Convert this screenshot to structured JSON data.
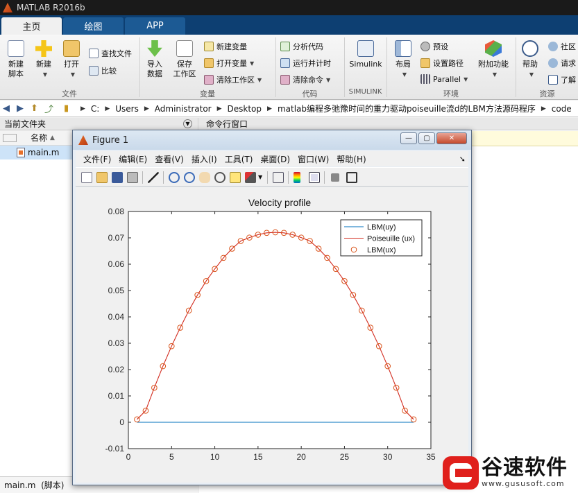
{
  "window": {
    "title": "MATLAB R2016b"
  },
  "tabs": [
    {
      "label": "主页",
      "active": true
    },
    {
      "label": "绘图",
      "active": false
    },
    {
      "label": "APP",
      "active": false
    }
  ],
  "ribbon": {
    "new_script": "新建\n脚本",
    "new": "新建",
    "open": "打开",
    "find_files": "查找文件",
    "compare": "比较",
    "import_data": "导入\n数据",
    "save_workspace": "保存\n工作区",
    "new_variable": "新建变量",
    "open_variable": "打开变量",
    "clear_workspace": "清除工作区",
    "analyze_code": "分析代码",
    "run_and_time": "运行并计时",
    "clear_commands": "清除命令",
    "simulink": "Simulink",
    "layout": "布局",
    "preferences": "预设",
    "set_path": "设置路径",
    "parallel": "Parallel",
    "addons": "附加功能",
    "help": "帮助",
    "community": "社区",
    "request": "请求",
    "learn": "了解",
    "groups": [
      "文件",
      "变量",
      "代码",
      "SIMULINK",
      "环境",
      "资源"
    ]
  },
  "address": {
    "crumbs": [
      "C:",
      "Users",
      "Administrator",
      "Desktop",
      "matlab编程多弛豫时间的重力驱动poiseuille流d的LBM方法源码程序",
      "code"
    ]
  },
  "file_browser": {
    "title": "当前文件夹",
    "col_name": "名称",
    "col_sort": "▲",
    "files": [
      {
        "name": "main.m"
      }
    ],
    "footer": "main.m  (脚本)"
  },
  "command_window": {
    "title": "命令行窗口"
  },
  "figure": {
    "title": "Figure 1",
    "menu": [
      "文件(F)",
      "编辑(E)",
      "查看(V)",
      "插入(I)",
      "工具(T)",
      "桌面(D)",
      "窗口(W)",
      "帮助(H)"
    ],
    "menu_arrow": "➘",
    "minimize": "—",
    "maximize": "▢",
    "close": "✕"
  },
  "chart_data": {
    "type": "line",
    "title": "Velocity profile",
    "xlabel": "",
    "ylabel": "",
    "xlim": [
      0,
      35
    ],
    "ylim": [
      -0.01,
      0.08
    ],
    "xticks": [
      0,
      5,
      10,
      15,
      20,
      25,
      30,
      35
    ],
    "yticks": [
      -0.01,
      0,
      0.01,
      0.02,
      0.03,
      0.04,
      0.05,
      0.06,
      0.07,
      0.08
    ],
    "grid": false,
    "legend": "top-right",
    "series": [
      {
        "name": "LBM(uy)",
        "kind": "line",
        "color": "#0072bd",
        "x": [
          1,
          33
        ],
        "y": [
          0,
          0
        ]
      },
      {
        "name": "Poiseuille (ux)",
        "kind": "line",
        "color": "#d22a1e",
        "x": [
          1,
          2,
          3,
          4,
          5,
          6,
          7,
          8,
          9,
          10,
          11,
          12,
          13,
          14,
          15,
          16,
          17,
          18,
          19,
          20,
          21,
          22,
          23,
          24,
          25,
          26,
          27,
          28,
          29,
          30,
          31,
          32,
          33
        ],
        "y": [
          0.0011,
          0.0044,
          0.0131,
          0.0213,
          0.0289,
          0.0359,
          0.0424,
          0.0483,
          0.0536,
          0.0582,
          0.0624,
          0.0659,
          0.0688,
          0.0701,
          0.0712,
          0.0719,
          0.0721,
          0.0719,
          0.0712,
          0.0701,
          0.0688,
          0.0659,
          0.0624,
          0.0582,
          0.0536,
          0.0483,
          0.0424,
          0.0359,
          0.0289,
          0.0213,
          0.0131,
          0.0044,
          0.0011
        ]
      },
      {
        "name": "LBM(ux)",
        "kind": "marker",
        "color": "#d95319",
        "x": [
          1,
          2,
          3,
          4,
          5,
          6,
          7,
          8,
          9,
          10,
          11,
          12,
          13,
          14,
          15,
          16,
          17,
          18,
          19,
          20,
          21,
          22,
          23,
          24,
          25,
          26,
          27,
          28,
          29,
          30,
          31,
          32,
          33
        ],
        "y": [
          0.0011,
          0.0044,
          0.0131,
          0.0213,
          0.0289,
          0.0359,
          0.0424,
          0.0483,
          0.0536,
          0.0582,
          0.0624,
          0.0659,
          0.0688,
          0.0701,
          0.0712,
          0.0719,
          0.0721,
          0.0719,
          0.0712,
          0.0701,
          0.0688,
          0.0659,
          0.0624,
          0.0582,
          0.0536,
          0.0483,
          0.0424,
          0.0359,
          0.0289,
          0.0213,
          0.0131,
          0.0044,
          0.0011
        ]
      }
    ]
  },
  "watermark": {
    "cn": "谷速软件",
    "url": "www.gususoft.com"
  }
}
